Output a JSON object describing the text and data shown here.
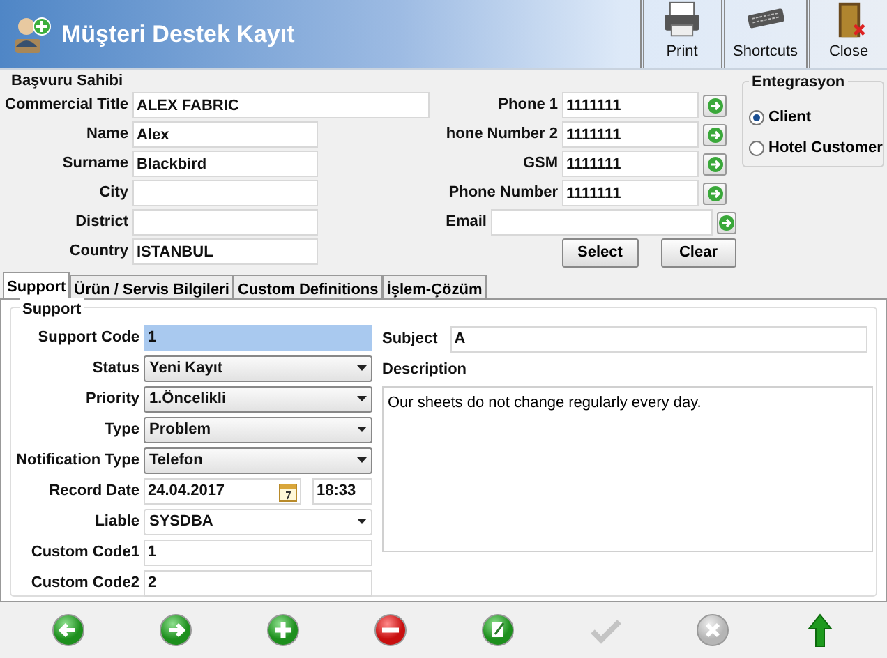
{
  "window": {
    "title": "Müşteri Destek Kayıt"
  },
  "toolbar": [
    {
      "label": "Print",
      "kind": "print"
    },
    {
      "label": "Shortcuts",
      "kind": "shortcuts"
    },
    {
      "label": "Close",
      "kind": "close"
    }
  ],
  "applicant": {
    "title": "Başvuru Sahibi",
    "fields": [
      {
        "label": "Commercial Title",
        "value": "ALEX FABRIC",
        "kind": "wide"
      },
      {
        "label": "Name",
        "value": "Alex",
        "kind": "text"
      },
      {
        "label": "Surname",
        "value": "Blackbird",
        "kind": "text"
      },
      {
        "label": "City",
        "kind": "text"
      },
      {
        "label": "District",
        "kind": "text"
      },
      {
        "label": "Country",
        "value": "ISTANBUL",
        "kind": "text"
      }
    ]
  },
  "contact": {
    "fields": [
      {
        "label": "Phone 1",
        "value": "1111111",
        "kind": "phone"
      },
      {
        "label": "hone Number 2",
        "value": "1111111",
        "kind": "phone"
      },
      {
        "label": "GSM",
        "value": "1111111",
        "kind": "phone"
      },
      {
        "label": "Phone Number",
        "value": "1111111",
        "kind": "phone"
      },
      {
        "label": "Email",
        "kind": "email"
      }
    ],
    "buttons": [
      "Select",
      "Clear"
    ]
  },
  "integration": {
    "title": "Entegrasyon",
    "options": [
      {
        "label": "Client",
        "selected": true
      },
      {
        "label": "Hotel Customer",
        "selected": false
      }
    ]
  },
  "tabs": [
    {
      "label": "Support",
      "selected": true
    },
    {
      "label": "Ürün / Servis Bilgileri",
      "selected": false
    },
    {
      "label": "Custom Definitions",
      "selected": false
    },
    {
      "label": "İşlem-Çözüm",
      "selected": false
    }
  ],
  "support": {
    "title": "Support",
    "fields": [
      {
        "label": "Support Code",
        "value": "1",
        "kind": "text",
        "focused": true
      },
      {
        "label": "Status",
        "value": "Yeni Kayıt",
        "kind": "select"
      },
      {
        "label": "Priority",
        "value": "1.Öncelikli",
        "kind": "select"
      },
      {
        "label": "Type",
        "value": "Problem",
        "kind": "select"
      },
      {
        "label": "Notification Type",
        "value": "Telefon",
        "kind": "select"
      },
      {
        "label": "Record Date",
        "value": "24.04.2017",
        "time": "18:33",
        "kind": "date"
      },
      {
        "label": "Liable",
        "value": "SYSDBA",
        "kind": "plainselect"
      },
      {
        "label": "Custom Code1",
        "value": "1",
        "kind": "text",
        "focused": false
      },
      {
        "label": "Custom Code2",
        "value": "2",
        "kind": "text",
        "focused": false
      }
    ],
    "subject": {
      "label": "Subject",
      "value": "A"
    },
    "description": {
      "label": "Description",
      "value": "Our sheets do not change regularly every day."
    }
  },
  "actions": [
    {
      "kind": "back",
      "disabled": false
    },
    {
      "kind": "forward",
      "disabled": false
    },
    {
      "kind": "add",
      "disabled": false
    },
    {
      "kind": "delete",
      "disabled": false
    },
    {
      "kind": "edit",
      "disabled": false
    },
    {
      "kind": "confirm",
      "disabled": true
    },
    {
      "kind": "cancel",
      "disabled": true
    },
    {
      "kind": "up",
      "disabled": false
    }
  ]
}
